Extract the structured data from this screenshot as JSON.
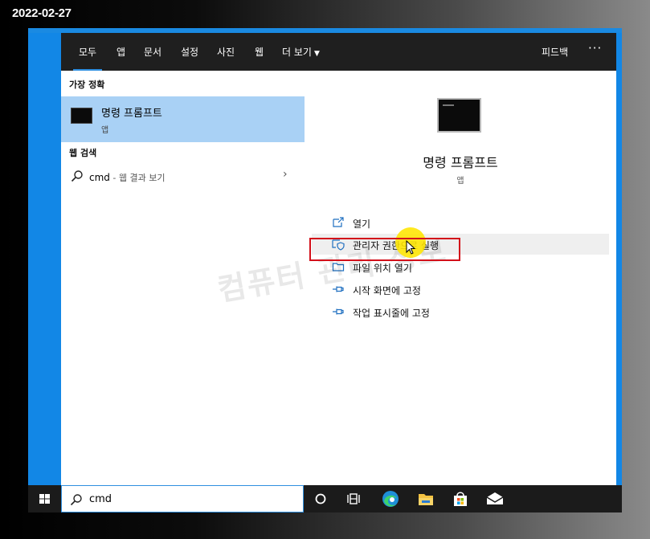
{
  "date_stamp": "2022-02-27",
  "watermark": "컴퓨터 관리 정보",
  "tabs": [
    {
      "label": "모두",
      "active": true
    },
    {
      "label": "앱"
    },
    {
      "label": "문서"
    },
    {
      "label": "설정"
    },
    {
      "label": "사진"
    },
    {
      "label": "웹"
    },
    {
      "label": "더 보기"
    }
  ],
  "header": {
    "feedback_label": "피드백",
    "more_options": "···"
  },
  "best_match": {
    "section_title": "가장 정확",
    "name": "명령 프롬프트",
    "type": "앱"
  },
  "web_search": {
    "section_title": "웹 검색",
    "query": "cmd",
    "suffix": " - 웹 결과 보기"
  },
  "detail": {
    "name": "명령 프롬프트",
    "type": "앱",
    "actions": [
      {
        "label": "열기",
        "icon": "open-icon"
      },
      {
        "label": "관리자 권한으로 실행",
        "icon": "shield-icon"
      },
      {
        "label": "파일 위치 열기",
        "icon": "folder-icon"
      },
      {
        "label": "시작 화면에 고정",
        "icon": "pin-icon"
      },
      {
        "label": "작업 표시줄에 고정",
        "icon": "pin-icon"
      }
    ]
  },
  "taskbar": {
    "search_value": "cmd",
    "icons": [
      "windows-logo-icon",
      "cortana-icon",
      "task-view-icon",
      "edge-icon",
      "file-explorer-icon",
      "store-icon",
      "mail-icon"
    ]
  },
  "colors": {
    "accent": "#2f8fe0",
    "selected_row": "#a9d1f5",
    "desktop": "#1287e6",
    "highlight_box": "#d3101a",
    "cursor_halo": "#ffe600"
  }
}
